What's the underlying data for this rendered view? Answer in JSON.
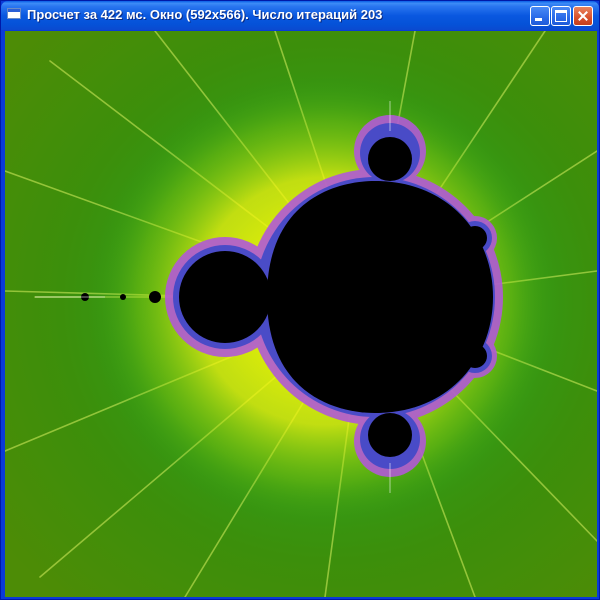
{
  "window": {
    "title": "Просчет за 422 мс. Окно (592x566). Число итераций 203",
    "icon": "window-app-icon",
    "controls": {
      "minimize_icon": "minimize-icon",
      "maximize_icon": "maximize-icon",
      "close_icon": "close-icon"
    }
  },
  "fractal": {
    "name": "mandelbrot-set-render",
    "iterations": 203,
    "colors": {
      "set": "#000000",
      "outer": "#3f8f00",
      "near": "#f0f000",
      "edge": "#9a3bd0"
    }
  }
}
